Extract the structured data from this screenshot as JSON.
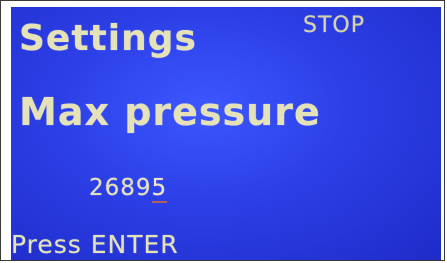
{
  "screen": {
    "title": "Settings",
    "status": "STOP",
    "parameter_label": "Max pressure",
    "value_digits": "2689",
    "value_cursor_digit": "5",
    "prompt": "Press ENTER"
  }
}
